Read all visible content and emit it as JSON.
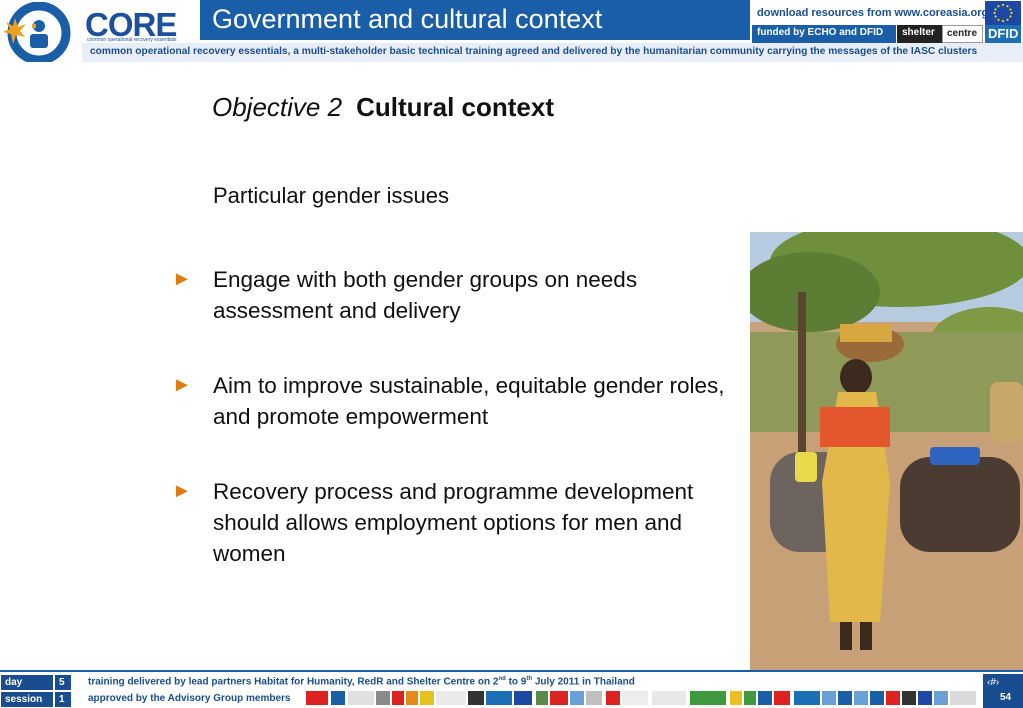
{
  "header": {
    "logo_ring_text": "common operational recovery essentials",
    "brand_name": "CORE",
    "brand_tagline": "common operational recovery essentials",
    "title": "Government and cultural context",
    "download_text": "download resources from www.coreasia.org",
    "funded_text": "funded by ECHO and DFID",
    "shelter_label": "shelter",
    "centre_label": "centre",
    "dfid_label": "DFID",
    "subtitle": "common operational recovery essentials, a multi-stakeholder basic technical training agreed and delivered by the humanitarian community carrying the messages of the IASC clusters"
  },
  "slide": {
    "objective_label": "Objective 2",
    "section_title": "Cultural context",
    "intro": "Particular gender issues",
    "bullets": [
      {
        "text": "Engage with both gender groups on needs assessment and delivery"
      },
      {
        "text": "Aim to improve sustainable, equitable gender roles, and promote empowerment"
      },
      {
        "text": "Recovery process and programme development should allows employment options for men and women"
      }
    ],
    "bullet_marker": "►"
  },
  "footer": {
    "day_label": "day",
    "day_value": "5",
    "session_label": "session",
    "session_value": "1",
    "training_prefix": "training delivered by lead partners Habitat for Humanity, RedR and Shelter Centre on 2",
    "training_sup1": "nd",
    "training_mid": " to 9",
    "training_sup2": "th",
    "training_suffix": " July 2011 in Thailand",
    "approved_text": "approved by the Advisory Group members",
    "page_number": "54",
    "page_icon": "‹#›"
  },
  "colors": {
    "brand_blue": "#1a5ea8",
    "dark_blue": "#1a4d8f",
    "bullet_orange": "#e07b12"
  }
}
